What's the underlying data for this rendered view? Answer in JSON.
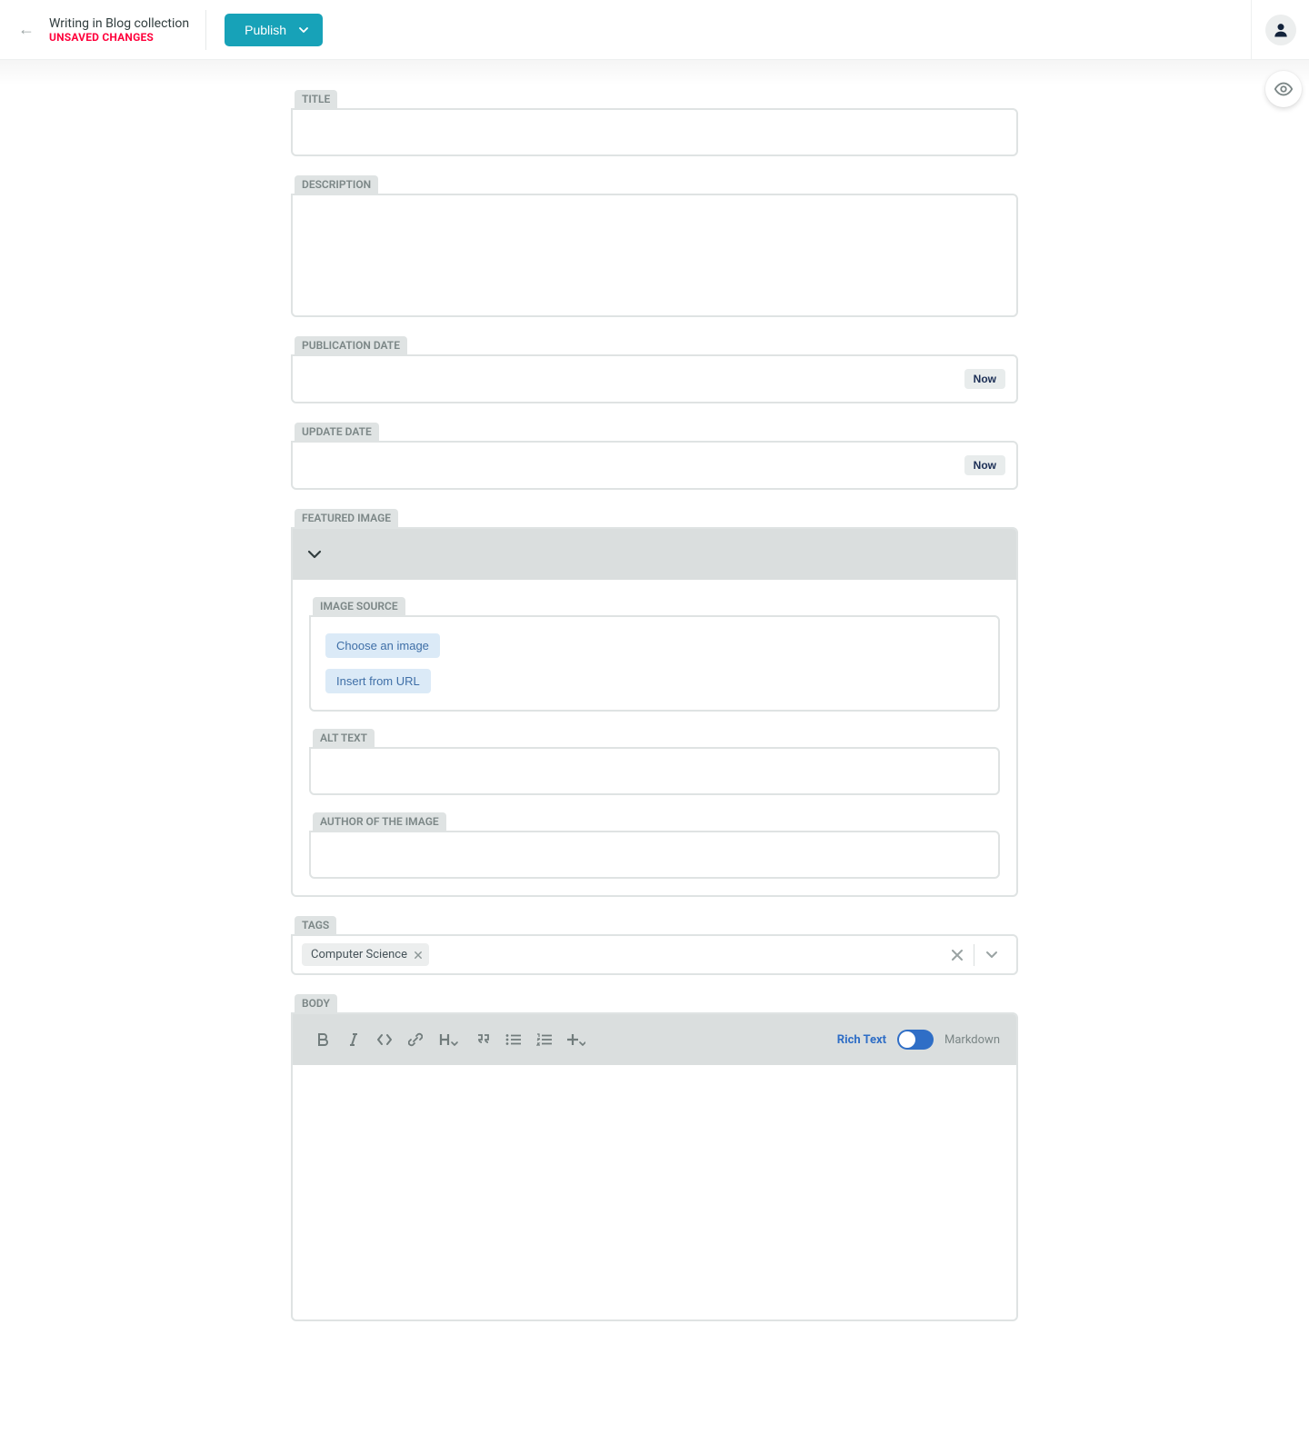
{
  "header": {
    "title": "Writing in Blog collection",
    "status": "UNSAVED CHANGES",
    "publish_label": "Publish"
  },
  "fields": {
    "title": {
      "label": "TITLE",
      "value": ""
    },
    "description": {
      "label": "DESCRIPTION",
      "value": ""
    },
    "publication_date": {
      "label": "PUBLICATION DATE",
      "value": "",
      "now": "Now"
    },
    "update_date": {
      "label": "UPDATE DATE",
      "value": "",
      "now": "Now"
    },
    "featured_image": {
      "label": "FEATURED IMAGE",
      "image_source": {
        "label": "IMAGE SOURCE",
        "choose": "Choose an image",
        "insert_url": "Insert from URL"
      },
      "alt_text": {
        "label": "ALT TEXT",
        "value": ""
      },
      "author": {
        "label": "AUTHOR OF THE IMAGE",
        "value": ""
      }
    },
    "tags": {
      "label": "TAGS",
      "items": [
        "Computer Science"
      ]
    },
    "body": {
      "label": "BODY",
      "mode_left": "Rich Text",
      "mode_right": "Markdown",
      "content": ""
    }
  }
}
